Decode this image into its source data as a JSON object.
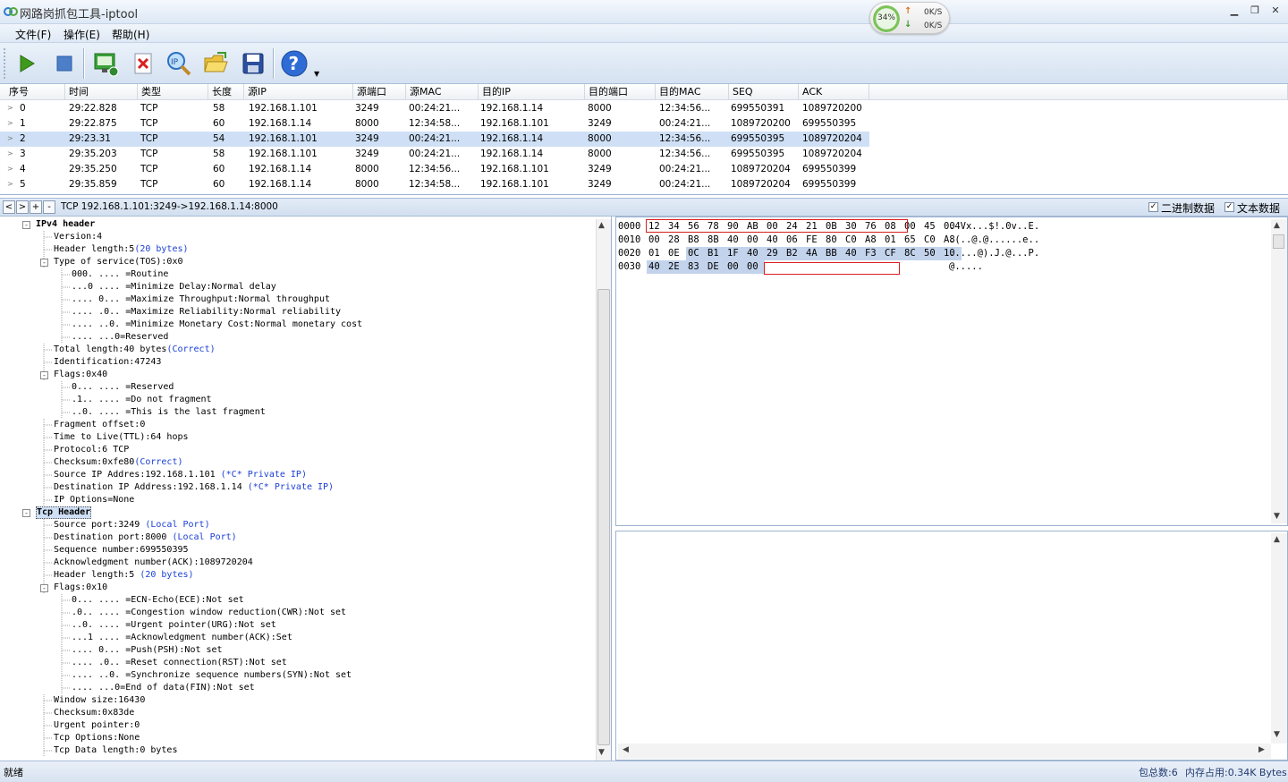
{
  "window": {
    "title": "网路岗抓包工具-iptool",
    "cpu_percent": "34%",
    "upload_speed": "0K/S",
    "download_speed": "0K/S",
    "controls": {
      "minimize": "▁",
      "restore": "❐",
      "close": "✕"
    }
  },
  "menu": {
    "file": "文件(F)",
    "operate": "操作(E)",
    "help": "帮助(H)"
  },
  "toolbar": {
    "icons": [
      "play-icon",
      "stop-icon",
      "network-filter-icon",
      "delete-icon",
      "ip-search-icon",
      "open-folder-icon",
      "save-icon",
      "help-icon"
    ]
  },
  "packet_table": {
    "headers": [
      "序号",
      "时间",
      "类型",
      "长度",
      "源IP",
      "源端口",
      "源MAC",
      "目的IP",
      "目的端口",
      "目的MAC",
      "SEQ",
      "ACK"
    ],
    "rows": [
      [
        "0",
        "29:22.828",
        "TCP",
        "58",
        "192.168.1.101",
        "3249",
        "00:24:21...",
        "192.168.1.14",
        "8000",
        "12:34:56...",
        "699550391",
        "1089720200"
      ],
      [
        "1",
        "29:22.875",
        "TCP",
        "60",
        "192.168.1.14",
        "8000",
        "12:34:58...",
        "192.168.1.101",
        "3249",
        "00:24:21...",
        "1089720200",
        "699550395"
      ],
      [
        "2",
        "29:23.31",
        "TCP",
        "54",
        "192.168.1.101",
        "3249",
        "00:24:21...",
        "192.168.1.14",
        "8000",
        "12:34:56...",
        "699550395",
        "1089720204"
      ],
      [
        "3",
        "29:35.203",
        "TCP",
        "58",
        "192.168.1.101",
        "3249",
        "00:24:21...",
        "192.168.1.14",
        "8000",
        "12:34:56...",
        "699550395",
        "1089720204"
      ],
      [
        "4",
        "29:35.250",
        "TCP",
        "60",
        "192.168.1.14",
        "8000",
        "12:34:56...",
        "192.168.1.101",
        "3249",
        "00:24:21...",
        "1089720204",
        "699550399"
      ],
      [
        "5",
        "29:35.859",
        "TCP",
        "60",
        "192.168.1.14",
        "8000",
        "12:34:58...",
        "192.168.1.101",
        "3249",
        "00:24:21...",
        "1089720204",
        "699550399"
      ]
    ],
    "selected_row": 2
  },
  "infobar": {
    "nav": [
      "<",
      ">",
      "+",
      "-"
    ],
    "summary": "TCP 192.168.1.101:3249->192.168.1.14:8000",
    "binary_label": "二进制数据",
    "text_label": "文本数据",
    "binary_checked": "✓",
    "text_checked": "✓"
  },
  "tree": {
    "nodes": [
      {
        "text": "IPv4 header",
        "note": "",
        "depth": 0,
        "toggle": "-",
        "bold": true
      },
      {
        "text": "Version:4",
        "note": "",
        "depth": 1
      },
      {
        "text": "Header length:5",
        "note": "(20 bytes)",
        "depth": 1
      },
      {
        "text": "Type of service(TOS):0x0",
        "note": "",
        "depth": 1,
        "toggle": "-"
      },
      {
        "text": "000. .... =Routine",
        "note": "",
        "depth": 2
      },
      {
        "text": "...0 .... =Minimize Delay:Normal delay",
        "note": "",
        "depth": 2
      },
      {
        "text": ".... 0... =Maximize Throughput:Normal throughput",
        "note": "",
        "depth": 2
      },
      {
        "text": ".... .0.. =Maximize Reliability:Normal reliability",
        "note": "",
        "depth": 2
      },
      {
        "text": ".... ..0. =Minimize Monetary Cost:Normal monetary cost",
        "note": "",
        "depth": 2
      },
      {
        "text": ".... ...0=Reserved",
        "note": "",
        "depth": 2
      },
      {
        "text": "Total length:40 bytes",
        "note": "(Correct)",
        "depth": 1
      },
      {
        "text": "Identification:47243",
        "note": "",
        "depth": 1
      },
      {
        "text": "Flags:0x40",
        "note": "",
        "depth": 1,
        "toggle": "-"
      },
      {
        "text": "0... .... =Reserved",
        "note": "",
        "depth": 2
      },
      {
        "text": ".1.. .... =Do not fragment",
        "note": "",
        "depth": 2
      },
      {
        "text": "..0. .... =This is the last fragment",
        "note": "",
        "depth": 2
      },
      {
        "text": "Fragment offset:0",
        "note": "",
        "depth": 1
      },
      {
        "text": "Time to Live(TTL):64 hops",
        "note": "",
        "depth": 1
      },
      {
        "text": "Protocol:6 TCP",
        "note": "",
        "depth": 1
      },
      {
        "text": "Checksum:0xfe80",
        "note": "(Correct)",
        "depth": 1
      },
      {
        "text": "Source IP Addres:192.168.1.101",
        "note": " (*C* Private IP)",
        "depth": 1
      },
      {
        "text": "Destination IP Address:192.168.1.14",
        "note": " (*C* Private IP)",
        "depth": 1
      },
      {
        "text": "IP Options=None",
        "note": "",
        "depth": 1
      },
      {
        "text": "Tcp Header",
        "note": "",
        "depth": 0,
        "toggle": "-",
        "bold": true,
        "selected": true
      },
      {
        "text": "Source port:3249",
        "note": " (Local Port)",
        "depth": 1
      },
      {
        "text": "Destination port:8000",
        "note": " (Local Port)",
        "depth": 1
      },
      {
        "text": "Sequence number:699550395",
        "note": "",
        "depth": 1
      },
      {
        "text": "Acknowledgment number(ACK):1089720204",
        "note": "",
        "depth": 1
      },
      {
        "text": "Header length:5",
        "note": " (20 bytes)",
        "depth": 1
      },
      {
        "text": "Flags:0x10",
        "note": "",
        "depth": 1,
        "toggle": "-"
      },
      {
        "text": "0... .... =ECN-Echo(ECE):Not set",
        "note": "",
        "depth": 2
      },
      {
        "text": ".0.. .... =Congestion window reduction(CWR):Not set",
        "note": "",
        "depth": 2
      },
      {
        "text": "..0. .... =Urgent pointer(URG):Not set",
        "note": "",
        "depth": 2
      },
      {
        "text": "...1 .... =Acknowledgment number(ACK):Set",
        "note": "",
        "depth": 2
      },
      {
        "text": ".... 0... =Push(PSH):Not set",
        "note": "",
        "depth": 2
      },
      {
        "text": ".... .0.. =Reset connection(RST):Not set",
        "note": "",
        "depth": 2
      },
      {
        "text": ".... ..0. =Synchronize sequence numbers(SYN):Not set",
        "note": "",
        "depth": 2
      },
      {
        "text": ".... ...0=End of data(FIN):Not set",
        "note": "",
        "depth": 2
      },
      {
        "text": "Window size:16430",
        "note": "",
        "depth": 1
      },
      {
        "text": "Checksum:0x83de",
        "note": "",
        "depth": 1
      },
      {
        "text": "Urgent pointer:0",
        "note": "",
        "depth": 1
      },
      {
        "text": "Tcp Options:None",
        "note": "",
        "depth": 1
      },
      {
        "text": "Tcp Data length:0 bytes",
        "note": "",
        "depth": 1
      }
    ]
  },
  "hex": {
    "rows": [
      {
        "offset": "0000",
        "bytes": [
          "12",
          "34",
          "56",
          "78",
          "90",
          "AB",
          "00",
          "24",
          "21",
          "0B",
          "30",
          "76",
          "08",
          "00",
          "45",
          "00"
        ],
        "ascii": ".4Vx...$!.0v..E."
      },
      {
        "offset": "0010",
        "bytes": [
          "00",
          "28",
          "B8",
          "8B",
          "40",
          "00",
          "40",
          "06",
          "FE",
          "80",
          "C0",
          "A8",
          "01",
          "65",
          "C0",
          "A8"
        ],
        "ascii": ".(..@.@......e.."
      },
      {
        "offset": "0020",
        "bytes": [
          "01",
          "0E",
          "0C",
          "B1",
          "1F",
          "40",
          "29",
          "B2",
          "4A",
          "BB",
          "40",
          "F3",
          "CF",
          "8C",
          "50",
          "10"
        ],
        "ascii": ".....@).J.@...P."
      },
      {
        "offset": "0030",
        "bytes": [
          "40",
          "2E",
          "83",
          "DE",
          "00",
          "00"
        ],
        "ascii": "@....."
      }
    ]
  },
  "status": {
    "left": "就绪",
    "packet_count": "包总数:6",
    "memory": "内存占用:0.34K Bytes"
  }
}
